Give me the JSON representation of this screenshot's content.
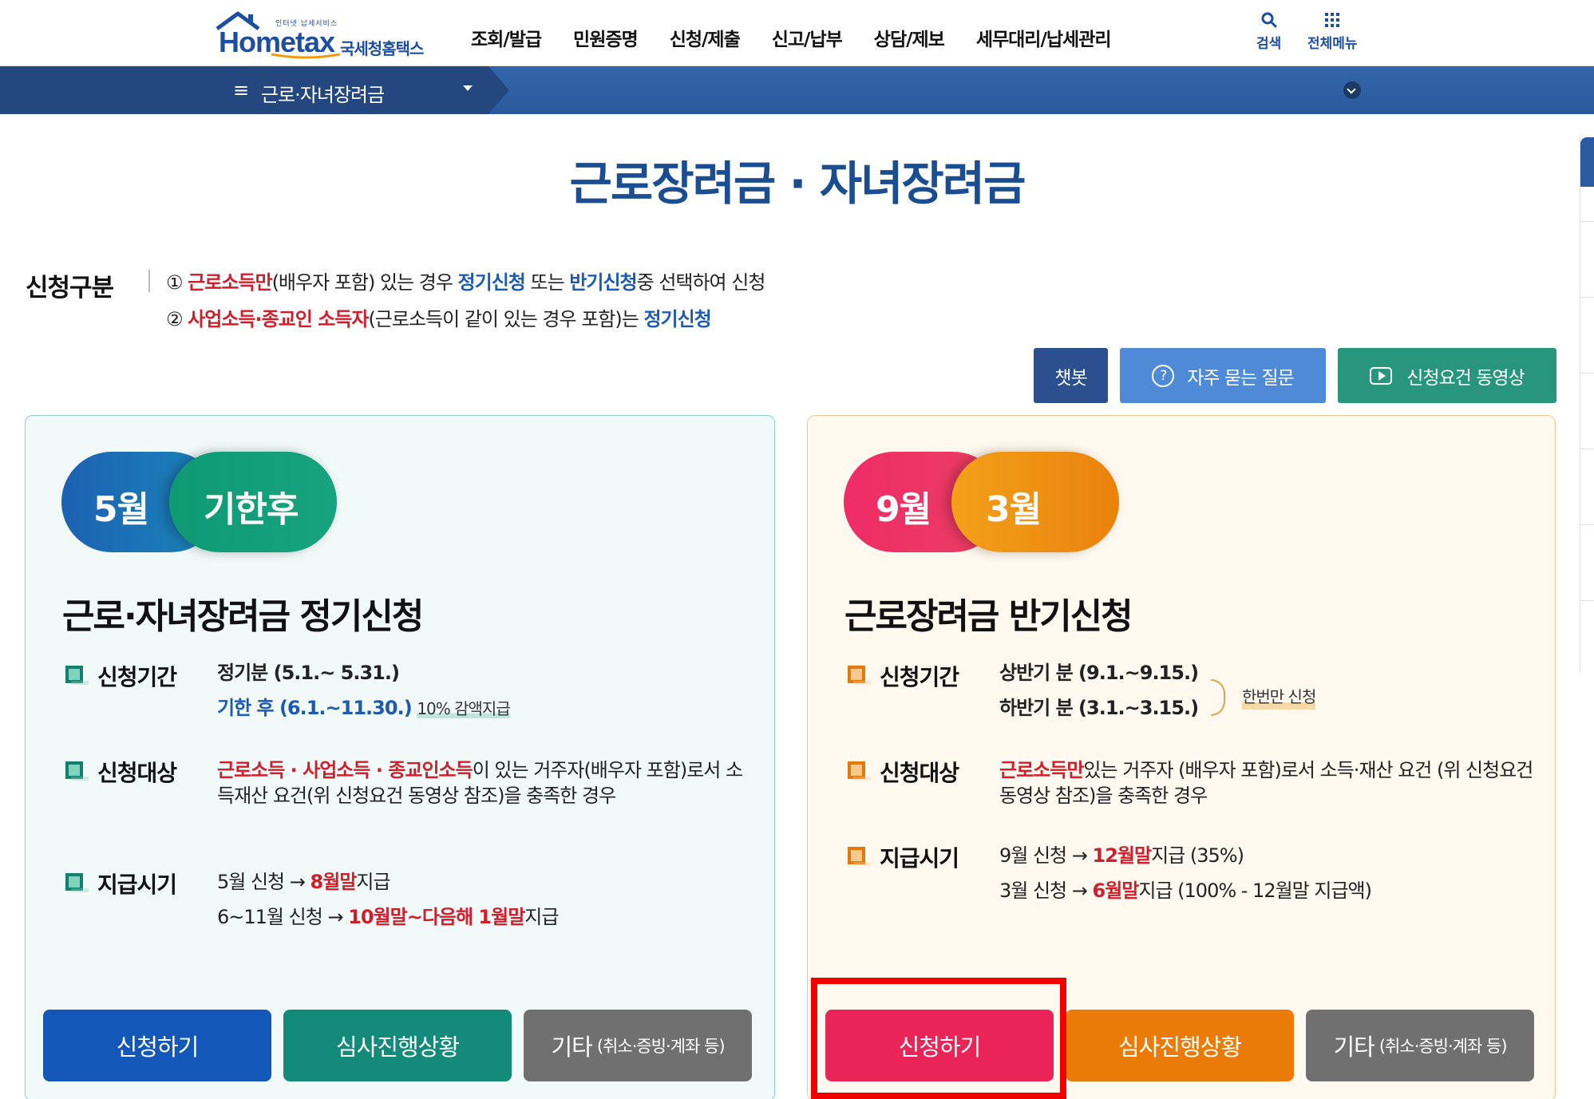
{
  "header": {
    "logo_small": "인터넷 납세서비스",
    "logo_brand": "Hometax",
    "logo_korean": "국세청홈택스",
    "nav": [
      "조회/발급",
      "민원증명",
      "신청/제출",
      "신고/납부",
      "상담/제보",
      "세무대리/납세관리"
    ],
    "search_label": "검색",
    "allmenu_label": "전체메뉴"
  },
  "subbar": {
    "menu_label": "근로·자녀장려금"
  },
  "page": {
    "title": "근로장려금 · 자녀장려금"
  },
  "category": {
    "label": "신청구분",
    "line1": {
      "num": "①",
      "red": "근로소득만",
      "mid": "(배우자 포함) 있는 경우 ",
      "blue1": "정기신청",
      "mid2": " 또는 ",
      "blue2": "반기신청",
      "end": "중 선택하여 신청"
    },
    "line2": {
      "num": "②",
      "red": "사업소득·종교인 소득자",
      "mid": "(근로소득이 같이 있는 경우 포함)는 ",
      "blue": "정기신청"
    }
  },
  "actions": {
    "chatbot": "챗봇",
    "faq": "자주 묻는 질문",
    "faq_icon": "?",
    "video": "신청요건 동영상"
  },
  "left_card": {
    "pill_a": "5월",
    "pill_b": "기한후",
    "title": "근로·자녀장려금 정기신청",
    "period_label": "신청기간",
    "period1": "정기분 (5.1.~ 5.31.)",
    "period2": "기한 후 (6.1.~11.30.)",
    "period2_note": "10% 감액지급",
    "target_label": "신청대상",
    "target_red": "근로소득 · 사업소득 · 종교인소득",
    "target_rest": "이 있는 거주자(배우자 포함)로서 소득재산 요건(위 신청요건 동영상 참조)을 충족한 경우",
    "pay_label": "지급시기",
    "pay1_pre": "5월 신청 → ",
    "pay1_red": "8월말",
    "pay1_post": "지급",
    "pay2_pre": "6~11월 신청 → ",
    "pay2_red": "10월말~다음해 1월말",
    "pay2_post": "지급",
    "btn_apply": "신청하기",
    "btn_status": "심사진행상황",
    "btn_etc": "기타",
    "btn_etc_small": "(취소·증빙·계좌 등)"
  },
  "right_card": {
    "pill_a": "9월",
    "pill_b": "3월",
    "title": "근로장려금 반기신청",
    "period_label": "신청기간",
    "period1": "상반기 분 (9.1.~9.15.)",
    "period2": "하반기 분 (3.1.~3.15.)",
    "period_note": "한번만 신청",
    "target_label": "신청대상",
    "target_red": "근로소득만",
    "target_rest": "있는 거주자 (배우자 포함)로서 소득·재산 요건 (위 신청요건 동영상 참조)을 충족한 경우",
    "pay_label": "지급시기",
    "pay1_pre": "9월 신청 → ",
    "pay1_red": "12월말",
    "pay1_post": "지급 (35%)",
    "pay2_pre": "3월 신청 → ",
    "pay2_red": "6월말",
    "pay2_post": "지급 (100% - 12월말 지급액)",
    "btn_apply": "신청하기",
    "btn_status": "심사진행상황",
    "btn_etc": "기타",
    "btn_etc_small": "(취소·증빙·계좌 등)"
  },
  "colors": {
    "brand_blue": "#1d4fa0",
    "title_blue": "#1b4e91",
    "red": "#d01f2c",
    "left_apply": "#1357b8",
    "left_status": "#148a7a",
    "etc_gray": "#707070",
    "right_apply": "#ea2456",
    "right_status": "#ea7b08",
    "highlight": "#f00000"
  }
}
